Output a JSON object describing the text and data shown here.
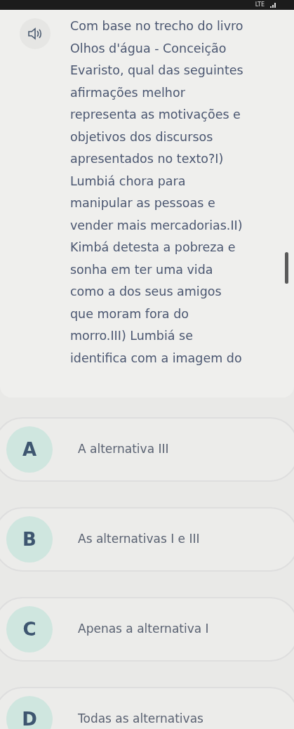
{
  "status_bar": {
    "network": "LTE"
  },
  "question": {
    "lines": [
      "Com base no trecho do livro",
      "Olhos d'água - Conceição",
      "Evaristo, qual das seguintes",
      "afirmações melhor",
      "representa as motivações e",
      "objetivos dos discursos",
      "apresentados no texto?I)",
      "Lumbiá chora para",
      "manipular as pessoas e",
      "vender mais mercadorias.II)",
      "Kimbá detesta a pobreza e",
      "sonha em ter uma vida",
      "como a dos seus amigos",
      "que moram fora do",
      "morro.III) Lumbiá se",
      "identifica com a imagem do"
    ]
  },
  "options": [
    {
      "letter": "A",
      "text": "A alternativa III",
      "selected": false
    },
    {
      "letter": "B",
      "text": "As alternativas I e III",
      "selected": false
    },
    {
      "letter": "C",
      "text": "Apenas a alternativa I",
      "selected": false
    },
    {
      "letter": "D",
      "text": "Todas as alternativas",
      "selected": false
    }
  ]
}
